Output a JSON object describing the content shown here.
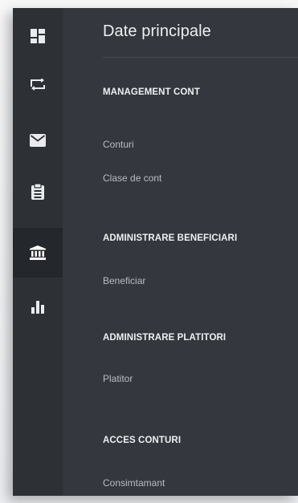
{
  "rail": {
    "items": [
      {
        "icon": "dashboard-icon",
        "active": false
      },
      {
        "icon": "transfer-icon",
        "active": false
      },
      {
        "icon": "mail-icon",
        "active": false
      },
      {
        "icon": "clipboard-icon",
        "active": false
      },
      {
        "icon": "bank-icon",
        "active": true
      },
      {
        "icon": "bar-chart-icon",
        "active": false
      }
    ]
  },
  "main": {
    "title": "Date principale",
    "sections": [
      {
        "heading": "MANAGEMENT CONT",
        "links": [
          "Conturi",
          "Clase de cont"
        ]
      },
      {
        "heading": "ADMINISTRARE BENEFICIARI",
        "links": [
          "Beneficiar"
        ]
      },
      {
        "heading": "ADMINISTRARE PLATITORI",
        "links": [
          "Platitor"
        ]
      },
      {
        "heading": "ACCES CONTURI",
        "links": [
          "Consimtamant"
        ]
      }
    ]
  },
  "colors": {
    "panel": "#34373d",
    "rail": "#2d3035",
    "rail_active": "#24272b",
    "icon": "#e9ebee",
    "heading": "#eef0f2",
    "link": "#b9bdc3"
  }
}
